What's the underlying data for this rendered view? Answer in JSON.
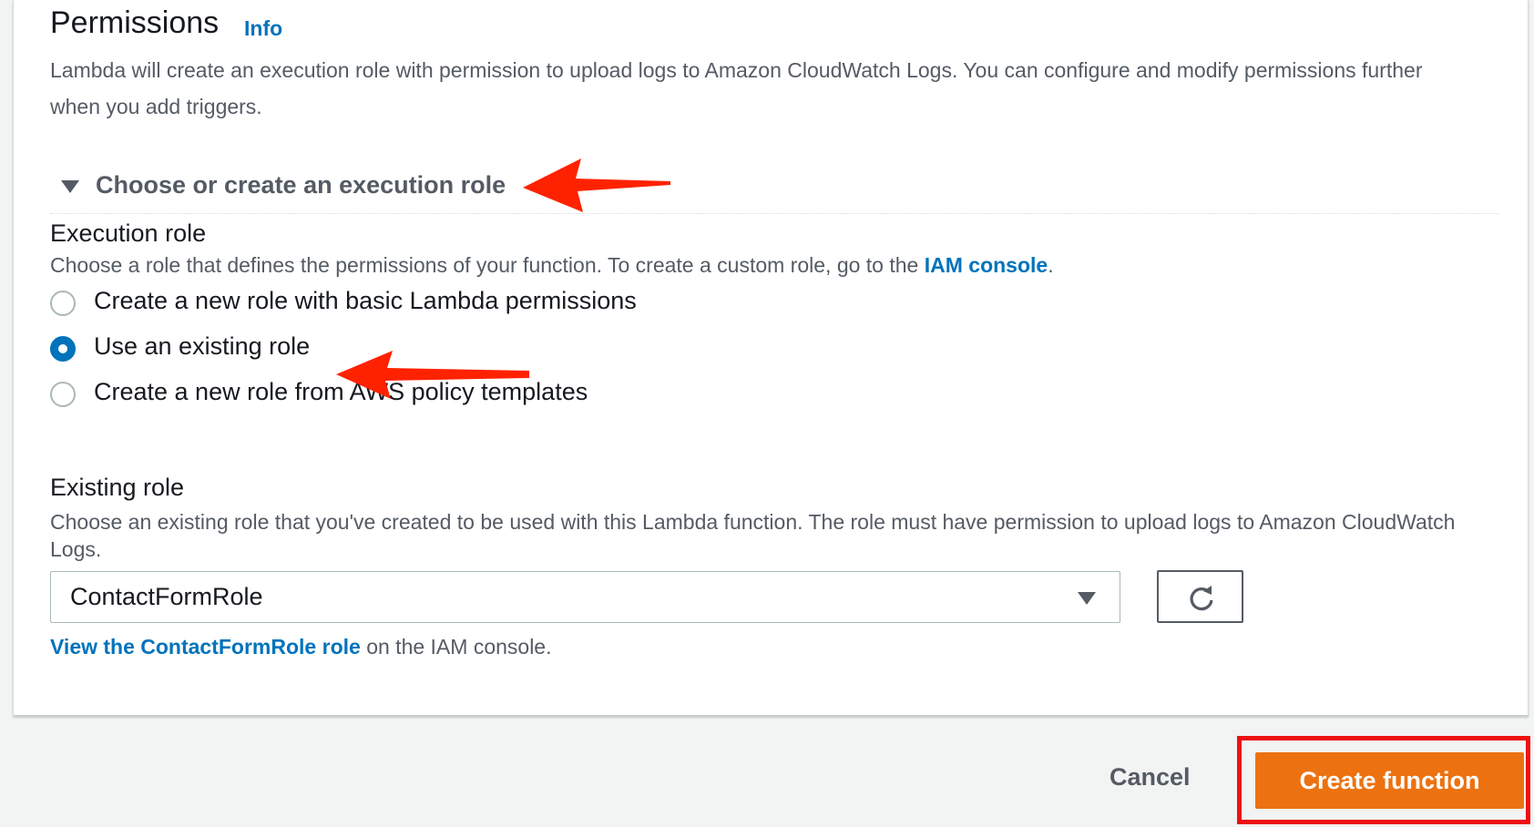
{
  "permissions": {
    "title": "Permissions",
    "info_link": "Info",
    "description": "Lambda will create an execution role with permission to upload logs to Amazon CloudWatch Logs. You can configure and modify permissions further when you add triggers."
  },
  "expander": {
    "label": "Choose or create an execution role",
    "expanded": true
  },
  "execution_role": {
    "label": "Execution role",
    "description_prefix": "Choose a role that defines the permissions of your function. To create a custom role, go to the",
    "iam_console_link": "IAM console",
    "description_suffix": ".",
    "options": [
      {
        "label": "Create a new role with basic Lambda permissions",
        "selected": false
      },
      {
        "label": "Use an existing role",
        "selected": true
      },
      {
        "label": "Create a new role from AWS policy templates",
        "selected": false
      }
    ]
  },
  "existing_role": {
    "label": "Existing role",
    "description": "Choose an existing role that you've created to be used with this Lambda function. The role must have permission to upload logs to Amazon CloudWatch Logs.",
    "selected_value": "ContactFormRole",
    "view_link": "View the ContactFormRole role",
    "view_suffix": "on the IAM console."
  },
  "footer": {
    "cancel_label": "Cancel",
    "create_label": "Create function"
  },
  "colors": {
    "link": "#0073bb",
    "primary_button": "#ec7211",
    "annotation": "#ee1111",
    "arrow": "#ff2200"
  },
  "icons": {
    "caret": "caret-down-icon",
    "refresh": "refresh-icon"
  }
}
